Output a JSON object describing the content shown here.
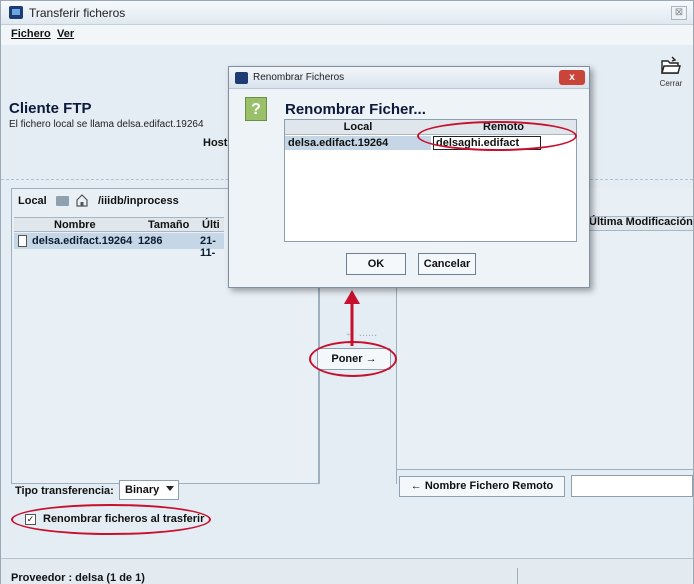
{
  "window": {
    "title": "Transferir ficheros",
    "close_glyph": "⊠"
  },
  "menu": {
    "items": [
      {
        "label": "Fichero"
      },
      {
        "label": "Ver"
      }
    ]
  },
  "toolbar": {
    "cerrar_label": "Cerrar",
    "cerrar_icon": "open-folder-icon"
  },
  "client": {
    "title": "Cliente FTP",
    "description": "El fichero local se llama delsa.edifact.19264",
    "host_label": "Host"
  },
  "local_panel": {
    "label": "Local",
    "path": "/iiidb/inprocess",
    "columns": [
      "Nombre",
      "Tamaño",
      "Últi"
    ],
    "rows": [
      {
        "nombre": "delsa.edifact.19264",
        "tamano": "1286",
        "ultima": "21-11-"
      }
    ]
  },
  "transfer_buttons": {
    "disabled_label": "← ......",
    "poner_label": "Poner →"
  },
  "remote_panel": {
    "ultima_header": "Última Modificación",
    "rename_remote_button": "← Nombre Fichero Remoto",
    "remote_input_value": ""
  },
  "transfer": {
    "tipo_label": "Tipo transferencia:",
    "tipo_value": "Binary",
    "rename_checkbox_label": "Renombrar ficheros al trasferir",
    "rename_checked": true
  },
  "status": {
    "text": "Proveedor : delsa (1 de 1)"
  },
  "dialog": {
    "title": "Renombrar Ficheros",
    "close_glyph": "x",
    "heading": "Renombrar Ficher...",
    "columns": {
      "local": "Local",
      "remoto": "Remoto"
    },
    "row": {
      "local": "delsa.edifact.19264",
      "remoto": "delsaghi.edifact"
    },
    "ok_label": "OK",
    "cancel_label": "Cancelar"
  },
  "colors": {
    "annotation_red": "#c8102e",
    "window_bg": "#e4edf3",
    "selection": "#c5d7e6"
  }
}
